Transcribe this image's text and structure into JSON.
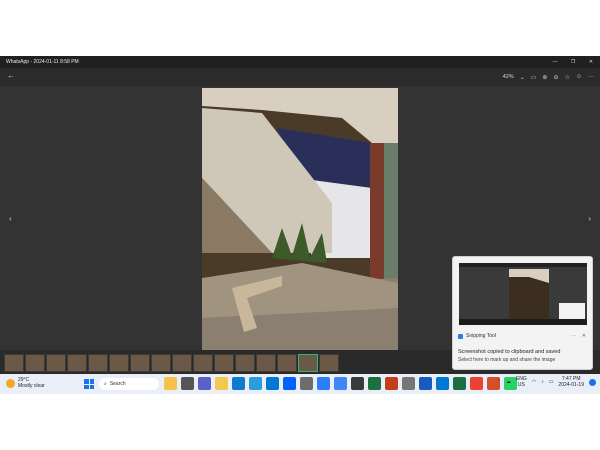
{
  "window": {
    "title": "WhatsApp - 2024-01-11 8:58 PM"
  },
  "toolbar": {
    "zoom": "42%"
  },
  "filmstrip": {
    "count": 17,
    "selected_index": 14
  },
  "toast": {
    "app_name": "Snipping Tool",
    "message": "Screenshot copied to clipboard and saved",
    "sub": "Select here to mark up and share the image",
    "more": "···",
    "close": "✕"
  },
  "taskbar": {
    "weather_temp": "29°C",
    "weather_desc": "Mostly clear",
    "search_placeholder": "Search",
    "lang_top": "ENG",
    "lang_bottom": "US",
    "time": "7:47 PM",
    "date": "2024-01-19"
  },
  "colors": {
    "accent": "#1a73e8",
    "selected_thumb": "#2fb47d"
  }
}
